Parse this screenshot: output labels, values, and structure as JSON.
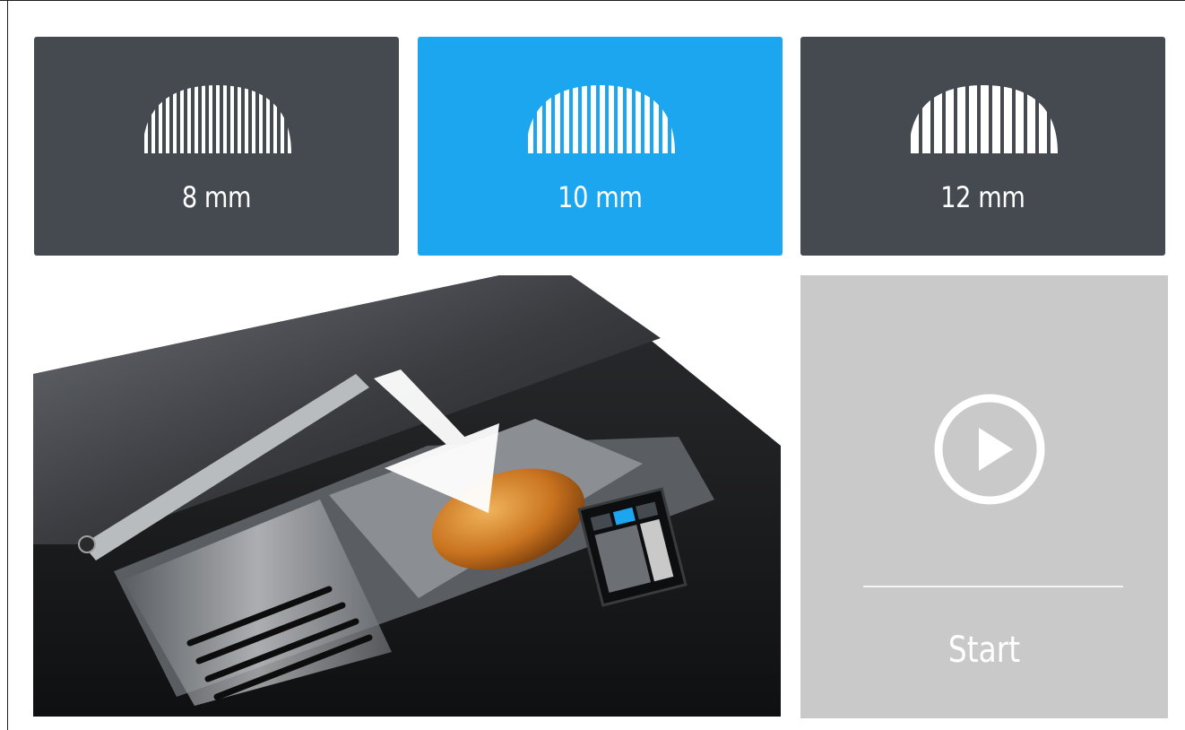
{
  "thickness_options": [
    {
      "label": "8 mm",
      "icon": "bread-slices-icon",
      "selected": false
    },
    {
      "label": "10 mm",
      "icon": "bread-slices-icon",
      "selected": true
    },
    {
      "label": "12 mm",
      "icon": "bread-slices-icon",
      "selected": false
    }
  ],
  "start": {
    "label": "Start",
    "icon": "play-icon"
  },
  "colors": {
    "button_default": "#454a50",
    "button_selected": "#1ba6ef",
    "start_panel": "#c9c9c9"
  }
}
